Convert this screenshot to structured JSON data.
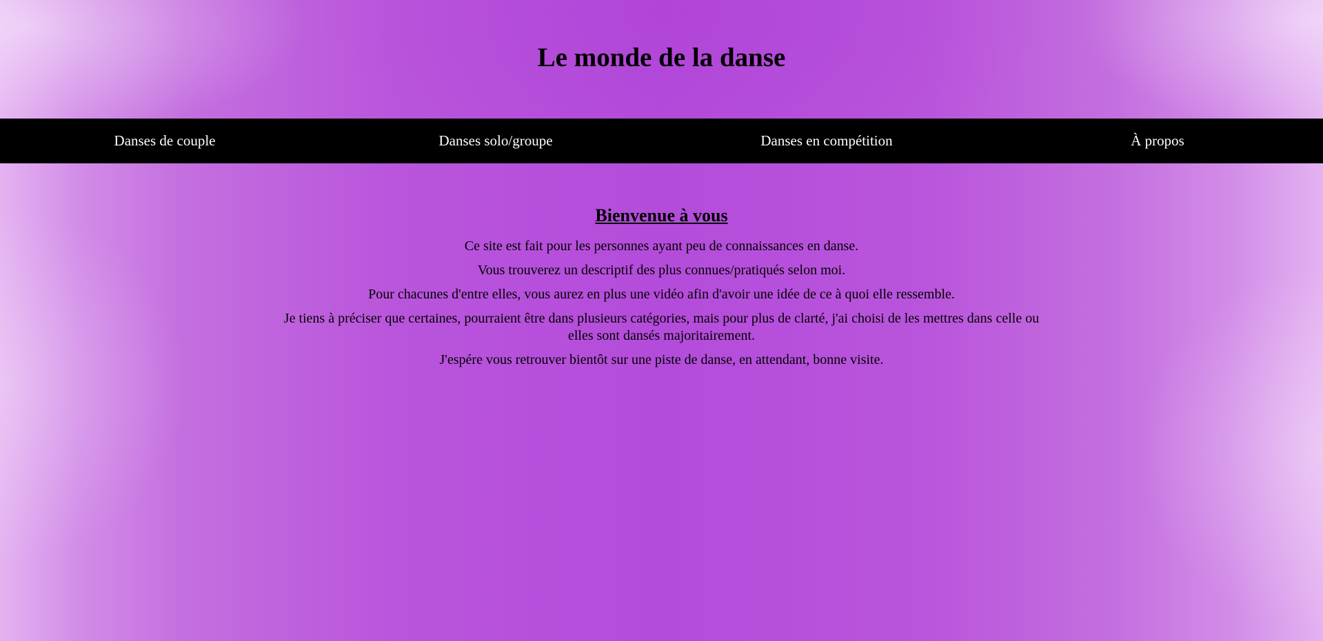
{
  "header": {
    "title": "Le monde de la danse"
  },
  "nav": {
    "items": [
      {
        "label": "Danses de couple"
      },
      {
        "label": "Danses solo/groupe"
      },
      {
        "label": "Danses en compétition"
      },
      {
        "label": "À propos"
      }
    ]
  },
  "main": {
    "heading": "Bienvenue à vous",
    "paragraphs": [
      "Ce site est fait pour les personnes ayant peu de connaissances en danse.",
      "Vous trouverez un descriptif des plus connues/pratiqués selon moi.",
      "Pour chacunes d'entre elles, vous aurez en plus une vidéo afin d'avoir une idée de ce à quoi elle ressemble.",
      "Je tiens à préciser que certaines, pourraient être dans plusieurs catégories, mais pour plus de clarté, j'ai choisi de les mettres dans celle ou elles sont dansés majoritairement.",
      "J'espére vous retrouver bientôt sur une piste de danse, en attendant, bonne visite."
    ]
  },
  "colors": {
    "background_center": "#b44cdb",
    "background_edge": "#e4b3f1",
    "nav_background": "#000000",
    "nav_text": "#ffffff",
    "text": "#000000"
  }
}
